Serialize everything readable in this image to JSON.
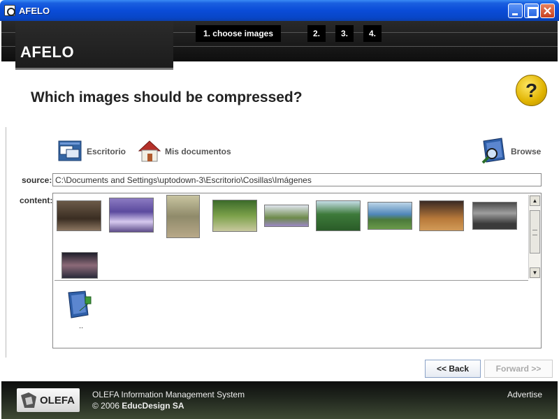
{
  "window": {
    "title": "AFELO"
  },
  "header": {
    "logo": "AFELO",
    "steps": [
      "1. choose images",
      "2.",
      "3.",
      "4."
    ]
  },
  "question": "Which images should be compressed?",
  "help_symbol": "?",
  "locations": {
    "desktop": "Escritorio",
    "documents": "Mis documentos",
    "browse": "Browse"
  },
  "source": {
    "label": "source:",
    "value": "C:\\Documents and Settings\\uptodown-3\\Escritorio\\Cosillas\\Imágenes"
  },
  "content": {
    "label": "content:",
    "parent_folder_label": ".."
  },
  "buttons": {
    "back": "<< Back",
    "forward": "Forward >>"
  },
  "footer": {
    "system": "OLEFA Information Management System",
    "copyright_prefix": "© 2006",
    "company": "EducDesign SA",
    "logo": "OLEFA",
    "advertise": "Advertise"
  },
  "colors": {
    "titlebar": "#0a4cd8",
    "header_bg": "#111111",
    "footer_bg": "#2a3224",
    "help_icon": "#e0b300"
  }
}
